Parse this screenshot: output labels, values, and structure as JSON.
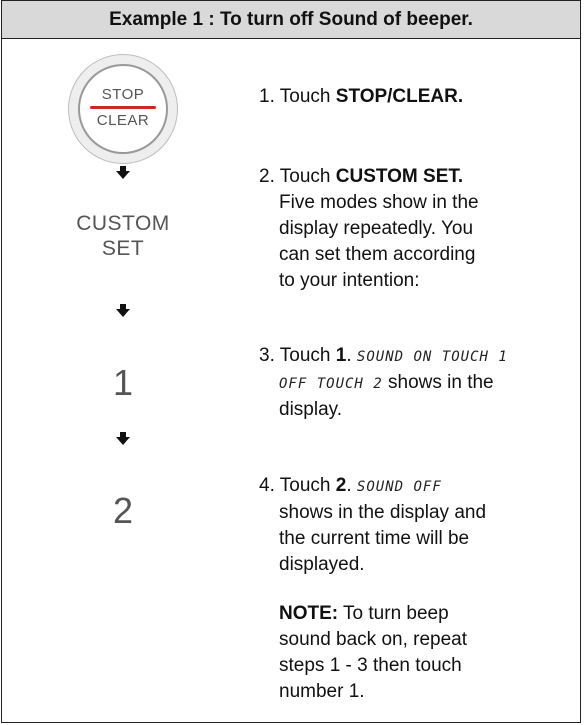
{
  "header": {
    "title": "Example 1 : To turn off Sound of beeper."
  },
  "left": {
    "stop_button": {
      "top_label": "STOP",
      "bottom_label": "CLEAR"
    },
    "custom_set": {
      "line1": "CUSTOM",
      "line2": "SET"
    },
    "key1": "1",
    "key2": "2"
  },
  "steps": {
    "s1": {
      "num": "1. Touch ",
      "bold": "STOP/CLEAR."
    },
    "s2": {
      "num": "2. Touch ",
      "bold": "CUSTOM SET.",
      "lines": [
        "Five modes show in the",
        "display repeatedly. You",
        "can set them according",
        "to your intention:"
      ]
    },
    "s3": {
      "num": "3. Touch ",
      "bold": "1",
      "dot": ". ",
      "lcd1": "SOUND ON TOUCH 1",
      "lcd2": "OFF TOUCH 2",
      "after": " shows in the",
      "line3": "display."
    },
    "s4": {
      "num": "4. Touch ",
      "bold": "2",
      "dot": ". ",
      "lcd": "SOUND OFF",
      "lines": [
        "shows in the display and",
        "the current time will be",
        "displayed."
      ]
    },
    "note": {
      "bold": "NOTE:",
      "first": " To turn beep",
      "lines": [
        "sound back on, repeat",
        "steps 1 - 3 then touch",
        "number 1."
      ]
    }
  }
}
